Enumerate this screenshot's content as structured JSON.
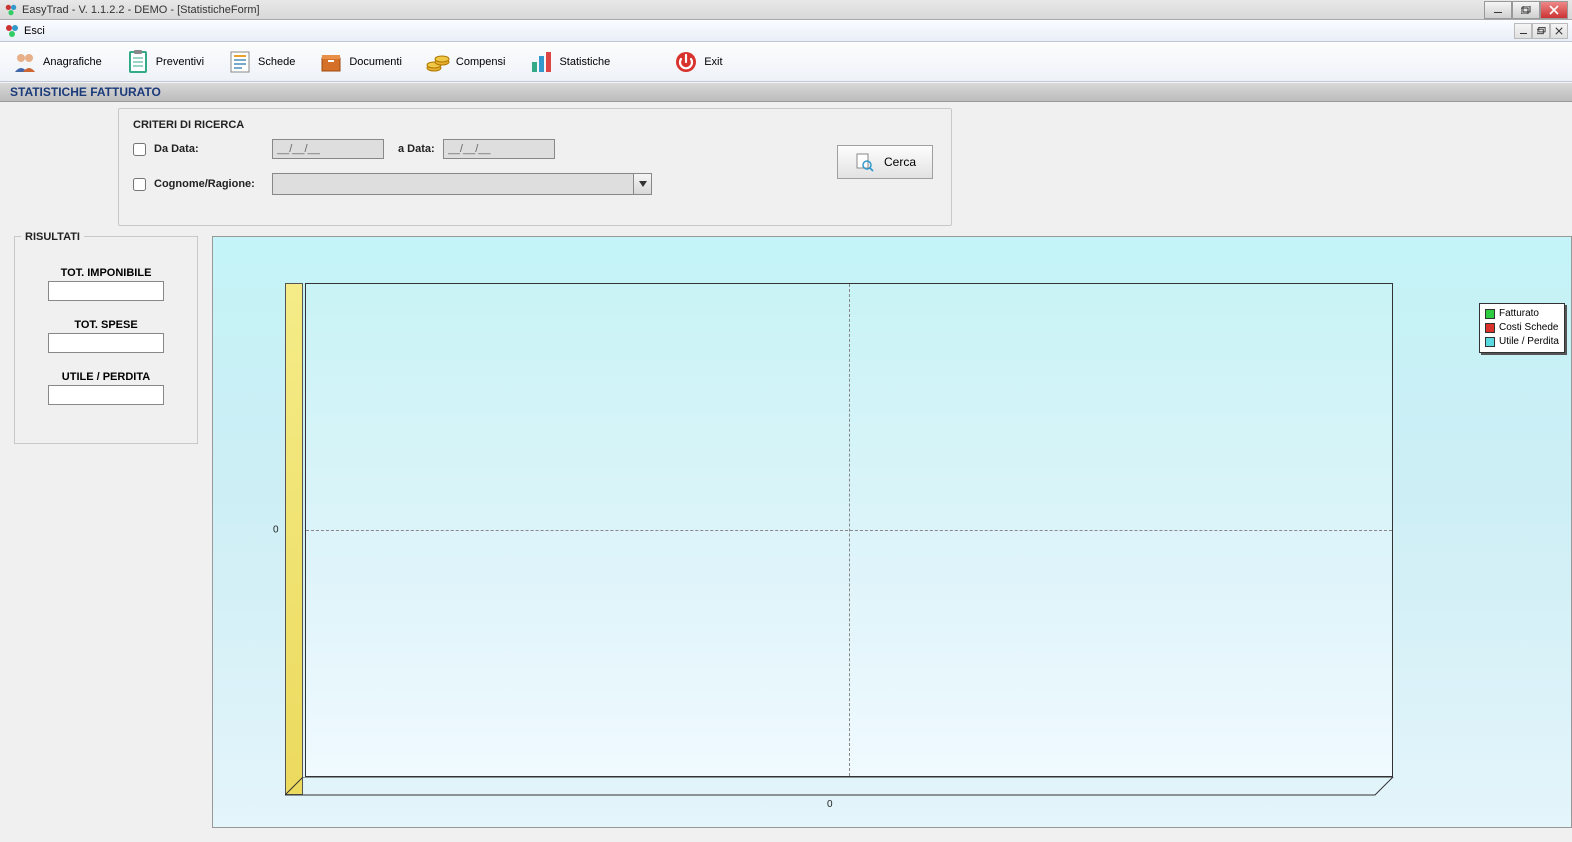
{
  "titlebar": {
    "text": "EasyTrad - V. 1.1.2.2 - DEMO - [StatisticheForm]"
  },
  "menubar": {
    "esci": "Esci"
  },
  "toolbar": {
    "anagrafiche": "Anagrafiche",
    "preventivi": "Preventivi",
    "schede": "Schede",
    "documenti": "Documenti",
    "compensi": "Compensi",
    "statistiche": "Statistiche",
    "exit": "Exit"
  },
  "section_title": "STATISTICHE FATTURATO",
  "criteria": {
    "title": "CRITERI DI RICERCA",
    "da_data_label": "Da Data:",
    "a_data_label": "a Data:",
    "date_placeholder": "__/__/__",
    "cognome_label": "Cognome/Ragione:",
    "cerca": "Cerca"
  },
  "results": {
    "title": "RISULTATI",
    "tot_imponibile": "TOT. IMPONIBILE",
    "tot_spese": "TOT. SPESE",
    "utile_perdita": "UTILE / PERDITA"
  },
  "chart_data": {
    "type": "bar",
    "categories": [
      "0"
    ],
    "series": [
      {
        "name": "Fatturato",
        "values": [
          0
        ],
        "color": "#2ecc40"
      },
      {
        "name": "Costi Schede",
        "values": [
          0
        ],
        "color": "#d9322d"
      },
      {
        "name": "Utile / Perdita",
        "values": [
          0
        ],
        "color": "#5ad8e0"
      }
    ],
    "xticks": [
      "0"
    ],
    "yticks": [
      "0"
    ],
    "ylim": [
      -1,
      1
    ]
  },
  "legend": {
    "items": [
      {
        "label": "Fatturato",
        "color": "#2ecc40"
      },
      {
        "label": "Costi Schede",
        "color": "#d9322d"
      },
      {
        "label": "Utile / Perdita",
        "color": "#5ad8e0"
      }
    ]
  }
}
